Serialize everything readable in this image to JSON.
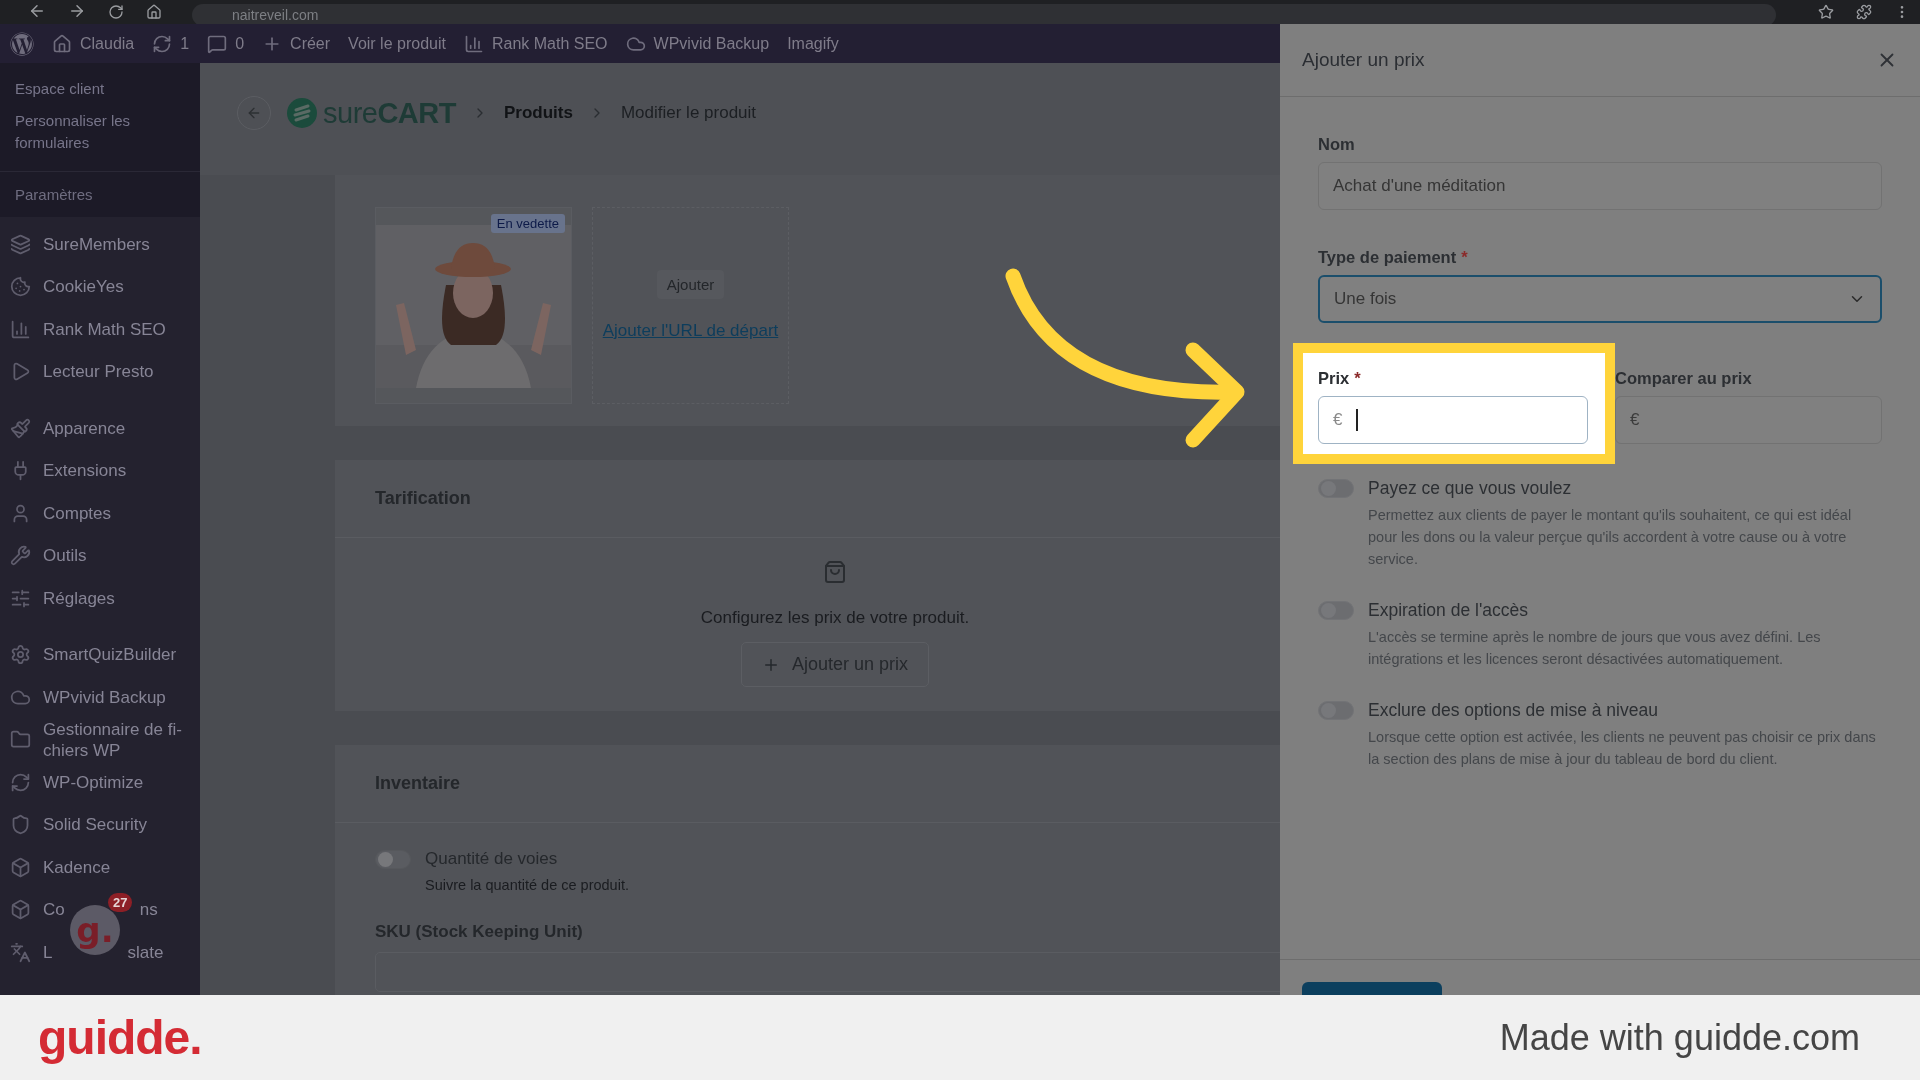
{
  "browser": {
    "url": "naitreveil.com"
  },
  "admin_bar": {
    "items": [
      {
        "kind": "wordpress"
      },
      {
        "kind": "home",
        "label": "Claudia"
      },
      {
        "kind": "updates",
        "label": "1"
      },
      {
        "kind": "comments",
        "label": "0"
      },
      {
        "kind": "new",
        "label": "Créer"
      },
      {
        "kind": "text",
        "label": "Voir le produit"
      },
      {
        "kind": "chart",
        "label": "Rank Math SEO"
      },
      {
        "kind": "cloud",
        "label": "WPvivid Backup"
      },
      {
        "kind": "text",
        "label": "Imagify"
      }
    ]
  },
  "sidebar": {
    "submenu": [
      {
        "label": "Espace client"
      },
      {
        "label": "Personnaliser les formulaires"
      }
    ],
    "submenu_footer": "Paramètres",
    "groups": [
      [
        {
          "kind": "layers",
          "label": "SureMembers"
        },
        {
          "kind": "cookie",
          "label": "CookieYes"
        },
        {
          "kind": "chart",
          "label": "Rank Math SEO"
        },
        {
          "kind": "play",
          "label": "Lecteur Presto"
        }
      ],
      [
        {
          "kind": "brush",
          "label": "Apparence"
        },
        {
          "kind": "plug",
          "label": "Extensions"
        },
        {
          "kind": "user",
          "label": "Comptes"
        },
        {
          "kind": "wrench",
          "label": "Outils"
        },
        {
          "kind": "sliders",
          "label": "Réglages"
        }
      ],
      [
        {
          "kind": "gear",
          "label": "SmartQuizBuilder"
        },
        {
          "kind": "cloud",
          "label": "WPvivid Backup"
        },
        {
          "kind": "folder",
          "label": "Gestionnaire de fi-chiers WP"
        },
        {
          "kind": "refresh",
          "label": "WP-Optimize"
        },
        {
          "kind": "shield",
          "label": "Solid Security"
        },
        {
          "kind": "box",
          "label": "Kadence"
        },
        {
          "kind": "box",
          "label": "Co",
          "label_end": "ns"
        },
        {
          "kind": "translate",
          "label": "L",
          "label_end": "slate"
        }
      ]
    ]
  },
  "recorder": {
    "glyph": "g.",
    "count": "27"
  },
  "header": {
    "logo_light": "sure",
    "logo_bold": "CART",
    "breadcrumbs": [
      "Produits",
      "Modifier le produit"
    ]
  },
  "media": {
    "badge": "En vedette",
    "add_button": "Ajouter",
    "link": "Ajouter l'URL de départ"
  },
  "pricing": {
    "title": "Tarification",
    "empty_text": "Configurez les prix de votre produit.",
    "button": "Ajouter un prix"
  },
  "inventory": {
    "title": "Inventaire",
    "toggle": {
      "label": "Quantité de voies",
      "description": "Suivre la quantité de ce produit.",
      "on": false
    },
    "sku_label": "SKU (Stock Keeping Unit)"
  },
  "drawer": {
    "title": "Ajouter un prix",
    "name_field": {
      "label": "Nom",
      "value": "Achat d'une méditation"
    },
    "payment_field": {
      "label": "Type de paiement",
      "value": "Une fois",
      "required_mark": "*"
    },
    "price_field": {
      "label": "Prix",
      "prefix": "€",
      "required_mark": "*",
      "focused": true
    },
    "compare_field": {
      "label": "Comparer au prix",
      "prefix": "€",
      "focused": false
    },
    "toggles": [
      {
        "label": "Payez ce que vous voulez",
        "description": "Permettez aux clients de payer le montant qu'ils souhaitent, ce qui est idéal pour les dons ou la valeur perçue qu'ils accordent à votre cause ou à votre service.",
        "on": false
      },
      {
        "label": "Expiration de l'accès",
        "description": "L'accès se termine après le nombre de jours que vous avez défini. Les intégrations et les licences seront désactivées automatiquement.",
        "on": false
      },
      {
        "label": "Exclure des options de mise à niveau",
        "description": "Lorsque cette option est activée, les clients ne peuvent pas choisir ce prix dans la section des plans de mise à jour du tableau de bord du client.",
        "on": false
      }
    ]
  },
  "footer": {
    "logo": "guidde.",
    "text": "Made with guidde.com"
  }
}
